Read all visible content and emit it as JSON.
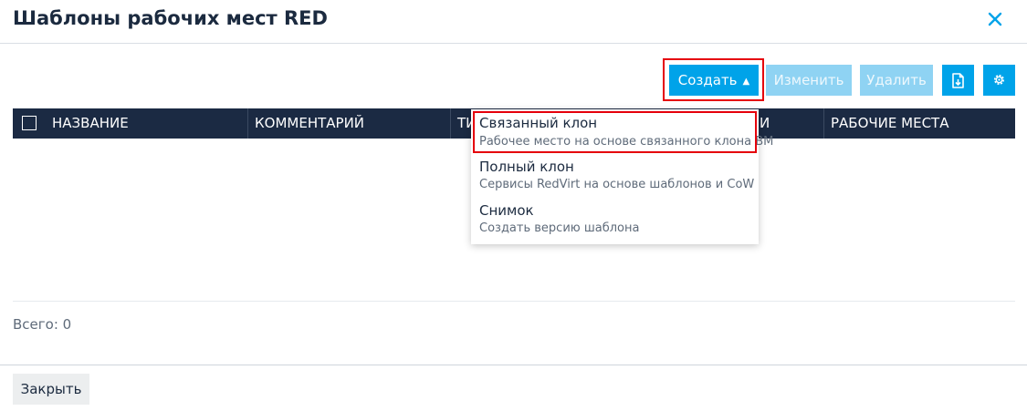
{
  "modal": {
    "title": "Шаблоны рабочих мест RED",
    "close_icon": "close-icon"
  },
  "toolbar": {
    "create_label": "Создать",
    "create_caret": "⌃",
    "edit_label": "Изменить",
    "delete_label": "Удалить",
    "export_icon": "export-icon",
    "settings_icon": "gear-icon"
  },
  "table": {
    "columns": [
      "НАЗВАНИЕ",
      "КОММЕНТАРИЙ",
      "ТИ",
      "И",
      "РАБОЧИЕ МЕСТА"
    ]
  },
  "create_menu": {
    "items": [
      {
        "title": "Связанный клон",
        "description": "Рабочее место на основе связанного клона ВМ"
      },
      {
        "title": "Полный клон",
        "description": "Сервисы RedVirt на основе шаблонов и CoW"
      },
      {
        "title": "Снимок",
        "description": "Создать версию шаблона"
      }
    ]
  },
  "footer": {
    "total_label": "Всего: 0",
    "close_label": "Закрыть"
  },
  "colors": {
    "primary": "#00a3e9",
    "primary_disabled": "#8fd3f3",
    "table_header": "#1b2a43",
    "highlight": "#e5000b"
  }
}
